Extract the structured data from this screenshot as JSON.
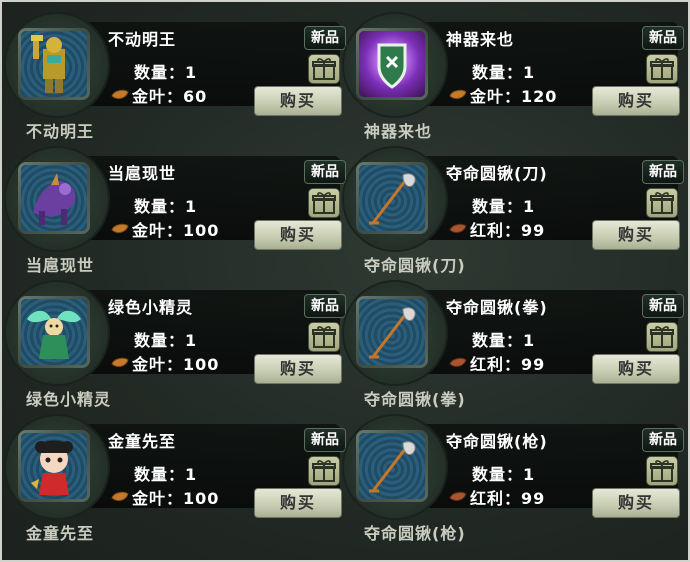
{
  "items": [
    {
      "title": "不动明王",
      "qty_label": "数量：1",
      "price_label": "金叶：60",
      "currency": "gold-leaf",
      "tag": "新品",
      "buy": "购买",
      "caption": "不动明王",
      "art": "armored-warrior"
    },
    {
      "title": "神器来也",
      "qty_label": "数量：1",
      "price_label": "金叶：120",
      "currency": "gold-leaf",
      "tag": "新品",
      "buy": "购买",
      "caption": "神器来也",
      "art": "glowing-shield"
    },
    {
      "title": "当扈现世",
      "qty_label": "数量：1",
      "price_label": "金叶：100",
      "currency": "gold-leaf",
      "tag": "新品",
      "buy": "购买",
      "caption": "当扈现世",
      "art": "purple-beast"
    },
    {
      "title": "夺命圆锹(刀)",
      "qty_label": "数量：1",
      "price_label": "红利：99",
      "currency": "red-bonus",
      "tag": "新品",
      "buy": "购买",
      "caption": "夺命圆锹(刀)",
      "art": "shovel"
    },
    {
      "title": "绿色小精灵",
      "qty_label": "数量：1",
      "price_label": "金叶：100",
      "currency": "gold-leaf",
      "tag": "新品",
      "buy": "购买",
      "caption": "绿色小精灵",
      "art": "green-fairy"
    },
    {
      "title": "夺命圆锹(拳)",
      "qty_label": "数量：1",
      "price_label": "红利：99",
      "currency": "red-bonus",
      "tag": "新品",
      "buy": "购买",
      "caption": "夺命圆锹(拳)",
      "art": "shovel"
    },
    {
      "title": "金童先至",
      "qty_label": "数量：1",
      "price_label": "金叶：100",
      "currency": "gold-leaf",
      "tag": "新品",
      "buy": "购买",
      "caption": "金童先至",
      "art": "golden-child"
    },
    {
      "title": "夺命圆锹(枪)",
      "qty_label": "数量：1",
      "price_label": "红利：99",
      "currency": "red-bonus",
      "tag": "新品",
      "buy": "购买",
      "caption": "夺命圆锹(枪)",
      "art": "shovel"
    }
  ],
  "colors": {
    "panel": "#222a25",
    "text": "#ffffff",
    "caption": "#c9ccbf",
    "button": "#d7dbc4",
    "tag_border": "#5b6e60"
  }
}
